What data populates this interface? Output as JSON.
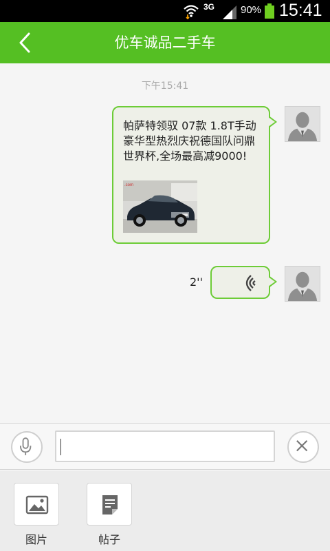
{
  "status_bar": {
    "network": "3G",
    "battery_percent": "90%",
    "time": "15:41"
  },
  "header": {
    "title": "优车诚品二手车"
  },
  "chat": {
    "timestamp": "下午15:41",
    "messages": [
      {
        "type": "text-image",
        "text": "帕萨特领驭 07款 1.8T手动豪华型热烈庆祝德国队问鼎世界杯,全场最高减9000!"
      },
      {
        "type": "voice",
        "duration": "2''"
      }
    ]
  },
  "input": {
    "value": "",
    "placeholder": ""
  },
  "attachments": [
    {
      "label": "图片",
      "icon": "image-icon"
    },
    {
      "label": "帖子",
      "icon": "post-icon"
    }
  ],
  "colors": {
    "brand_green": "#55bf23",
    "bubble_border": "#6dcc37"
  }
}
